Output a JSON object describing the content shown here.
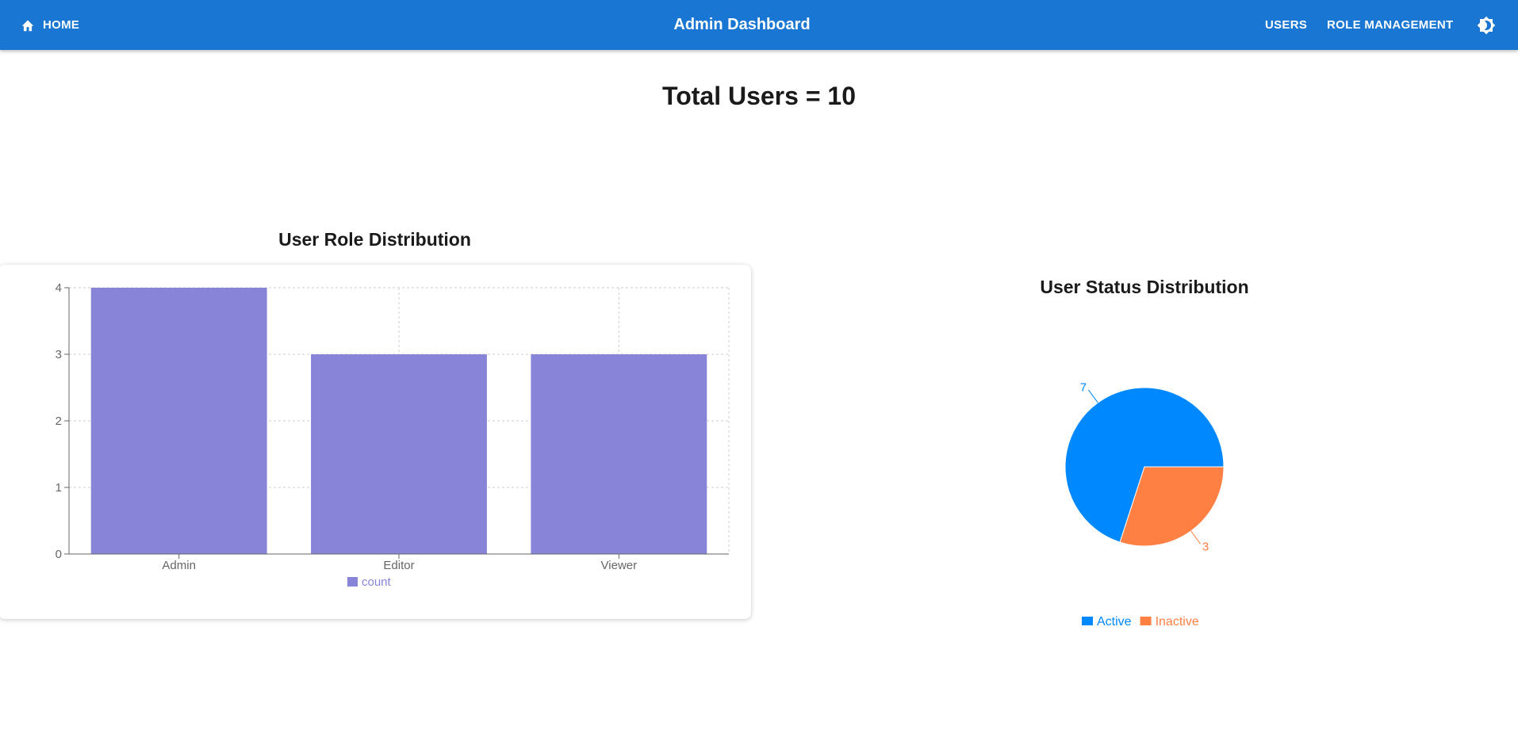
{
  "header": {
    "home_label": "HOME",
    "title": "Admin Dashboard",
    "users_label": "USERS",
    "role_management_label": "ROLE MANAGEMENT",
    "theme_icon": "brightness-icon",
    "bar_color": "#1976d2"
  },
  "summary": {
    "total_users_text": "Total Users = 10"
  },
  "role_chart": {
    "title": "User Role Distribution"
  },
  "status_chart": {
    "title": "User Status Distribution"
  },
  "chart_data": [
    {
      "type": "bar",
      "title": "User Role Distribution",
      "categories": [
        "Admin",
        "Editor",
        "Viewer"
      ],
      "series": [
        {
          "name": "count",
          "values": [
            4,
            3,
            3
          ],
          "color": "#8884d8"
        }
      ],
      "ylim": [
        0,
        4
      ],
      "yticks": [
        0,
        1,
        2,
        3,
        4
      ],
      "grid": true,
      "legend": "bottom"
    },
    {
      "type": "pie",
      "title": "User Status Distribution",
      "labels": [
        "Active",
        "Inactive"
      ],
      "values": [
        7,
        3
      ],
      "colors": [
        "#0088fe",
        "#ff8042"
      ],
      "data_labels": true,
      "legend": "bottom"
    }
  ]
}
